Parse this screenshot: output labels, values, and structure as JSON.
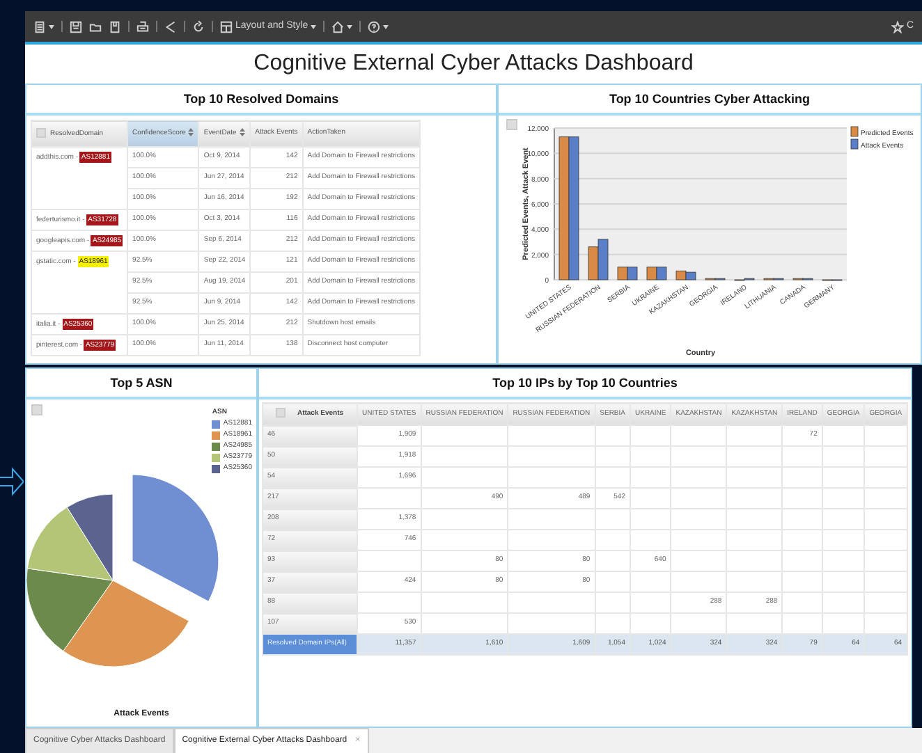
{
  "toolbar": {
    "layout_menu": "Layout and Style",
    "account_label": "C"
  },
  "dashboard_title": "Cognitive External Cyber Attacks Dashboard",
  "resolved_domains": {
    "title": "Top 10 Resolved Domains",
    "columns": [
      {
        "label": "ResolvedDomain",
        "sorted": false,
        "sortable": false
      },
      {
        "label": "ConfidenceScore",
        "sorted": true,
        "sortable": true
      },
      {
        "label": "EventDate",
        "sorted": false,
        "sortable": true
      },
      {
        "label": "Attack Events",
        "sorted": false,
        "sortable": false
      },
      {
        "label": "ActionTaken",
        "sorted": false,
        "sortable": false
      }
    ],
    "groups": [
      {
        "domain": "addthis.com - ",
        "asn": "AS12881",
        "color": "#a3171b",
        "events": [
          {
            "score": "100.0%",
            "date": "Oct 9, 2014",
            "count": "142",
            "action": "Add Domain to Firewall restrictions"
          },
          {
            "score": "100.0%",
            "date": "Jun 27, 2014",
            "count": "212",
            "action": "Add Domain to Firewall restrictions"
          },
          {
            "score": "100.0%",
            "date": "Jun 16, 2014",
            "count": "192",
            "action": "Add Domain to Firewall restrictions"
          }
        ]
      },
      {
        "domain": "federturismo.it - ",
        "asn": "AS31728",
        "color": "#a3171b",
        "events": [
          {
            "score": "100.0%",
            "date": "Oct 3, 2014",
            "count": "116",
            "action": "Add Domain to Firewall restrictions"
          }
        ]
      },
      {
        "domain": "googleapis.com - ",
        "asn": "AS24985",
        "color": "#a3171b",
        "events": [
          {
            "score": "100.0%",
            "date": "Sep 6, 2014",
            "count": "212",
            "action": "Add Domain to Firewall restrictions"
          }
        ]
      },
      {
        "domain": "gstatic.com - ",
        "asn": "AS18961",
        "color": "#f4f000",
        "events": [
          {
            "score": "92.5%",
            "date": "Sep 22, 2014",
            "count": "121",
            "action": "Add Domain to Firewall restrictions"
          },
          {
            "score": "92.5%",
            "date": "Aug 19, 2014",
            "count": "201",
            "action": "Add Domain to Firewall restrictions"
          },
          {
            "score": "92.5%",
            "date": "Jun 9, 2014",
            "count": "142",
            "action": "Add Domain to Firewall restrictions"
          }
        ]
      },
      {
        "domain": "italia.it - ",
        "asn": "AS25360",
        "color": "#a3171b",
        "events": [
          {
            "score": "100.0%",
            "date": "Jun 25, 2014",
            "count": "212",
            "action": "Shutdown host emails"
          }
        ]
      },
      {
        "domain": "pinterest.com - ",
        "asn": "AS23779",
        "color": "#a3171b",
        "events": [
          {
            "score": "100.0%",
            "date": "Jun 11, 2014",
            "count": "138",
            "action": "Disconnect host computer"
          }
        ]
      }
    ]
  },
  "countries": {
    "title": "Top 10 Countries Cyber Attacking",
    "chart_data": {
      "type": "bar",
      "xlabel": "Country",
      "ylabel": "Predicted Events, Attack Event",
      "categories": [
        "UNITED STATES",
        "RUSSIAN FEDERATION",
        "SERBIA",
        "UKRAINE",
        "KAZAKHSTAN",
        "GEORGIA",
        "IRELAND",
        "LITHUANIA",
        "CANADA",
        "GERMANY"
      ],
      "series": [
        {
          "name": "Predicted Events",
          "color": "#d98b45",
          "values": [
            11300,
            2600,
            1000,
            1000,
            700,
            100,
            0,
            100,
            100,
            0
          ]
        },
        {
          "name": "Attack Events",
          "color": "#5a7fc8",
          "values": [
            11300,
            3200,
            1000,
            1000,
            600,
            100,
            100,
            100,
            100,
            0
          ]
        }
      ],
      "grid": true,
      "legend": "right",
      "ylim": [
        0,
        12000
      ],
      "yticks": [
        {
          "value": 0,
          "label": "0"
        },
        {
          "value": 2000,
          "label": "2,000"
        },
        {
          "value": 4000,
          "label": "4,000"
        },
        {
          "value": 6000,
          "label": "6,000"
        },
        {
          "value": 8000,
          "label": "8,000"
        },
        {
          "value": 10000,
          "label": "10,000"
        },
        {
          "value": 12000,
          "label": "12,000"
        }
      ]
    }
  },
  "asn_chart": {
    "title": "Top 5 ASN",
    "legend_title": "ASN",
    "xlabel": "Attack Events",
    "legend": [
      {
        "label": "AS12881",
        "color": "#6f8fd2"
      },
      {
        "label": "AS18961",
        "color": "#de9552"
      },
      {
        "label": "AS24985",
        "color": "#6b8a4c"
      },
      {
        "label": "AS23779",
        "color": "#b3c678"
      },
      {
        "label": "AS25360",
        "color": "#5b648f"
      }
    ]
  },
  "ip_table": {
    "title": "Top 10 IPs by Top 10 Countries",
    "corner": "Attack Events",
    "columns": [
      "UNITED STATES",
      "RUSSIAN FEDERATION",
      "RUSSIAN FEDERATION",
      "SERBIA",
      "UKRAINE",
      "KAZAKHSTAN",
      "KAZAKHSTAN",
      "IRELAND",
      "GEORGIA",
      "GEORGIA"
    ],
    "rows": [
      {
        "kind": "ip",
        "label": "46",
        "cells": [
          "1,909",
          null,
          null,
          null,
          null,
          null,
          null,
          "72",
          null,
          null
        ]
      },
      {
        "kind": "ip",
        "label": "50",
        "cells": [
          "1,918",
          null,
          null,
          null,
          null,
          null,
          null,
          null,
          null,
          null
        ]
      },
      {
        "kind": "ip",
        "label": "54",
        "cells": [
          "1,696",
          null,
          null,
          null,
          null,
          null,
          null,
          null,
          null,
          null
        ]
      },
      {
        "kind": "ip",
        "label": "217",
        "cells": [
          null,
          "490",
          "489",
          "542",
          null,
          null,
          null,
          null,
          null,
          null
        ]
      },
      {
        "kind": "ip",
        "label": "208",
        "cells": [
          "1,378",
          null,
          null,
          null,
          null,
          null,
          null,
          null,
          null,
          null
        ]
      },
      {
        "kind": "ip",
        "label": "72",
        "cells": [
          "746",
          null,
          null,
          null,
          null,
          null,
          null,
          null,
          null,
          null
        ]
      },
      {
        "kind": "ip",
        "label": "93",
        "cells": [
          null,
          "80",
          "80",
          null,
          "640",
          null,
          null,
          null,
          null,
          null
        ]
      },
      {
        "kind": "ip",
        "label": "37",
        "cells": [
          "424",
          "80",
          "80",
          null,
          null,
          null,
          null,
          null,
          null,
          null
        ]
      },
      {
        "kind": "ip",
        "label": "88",
        "cells": [
          null,
          null,
          null,
          null,
          null,
          "288",
          "288",
          null,
          null,
          null
        ]
      },
      {
        "kind": "ip",
        "label": "107",
        "cells": [
          "530",
          null,
          null,
          null,
          null,
          null,
          null,
          null,
          null,
          null
        ]
      },
      {
        "kind": "total",
        "label": "Resolved Domain IPs(All)",
        "cells": [
          "11,357",
          "1,610",
          "1,609",
          "1,054",
          "1,024",
          "324",
          "324",
          "79",
          "64",
          "64"
        ]
      }
    ]
  },
  "tabs": [
    {
      "label": "Cognitive Cyber Attacks Dashboard",
      "selected": false
    },
    {
      "label": "Cognitive External Cyber Attacks Dashboard",
      "selected": true,
      "close": "×"
    }
  ]
}
